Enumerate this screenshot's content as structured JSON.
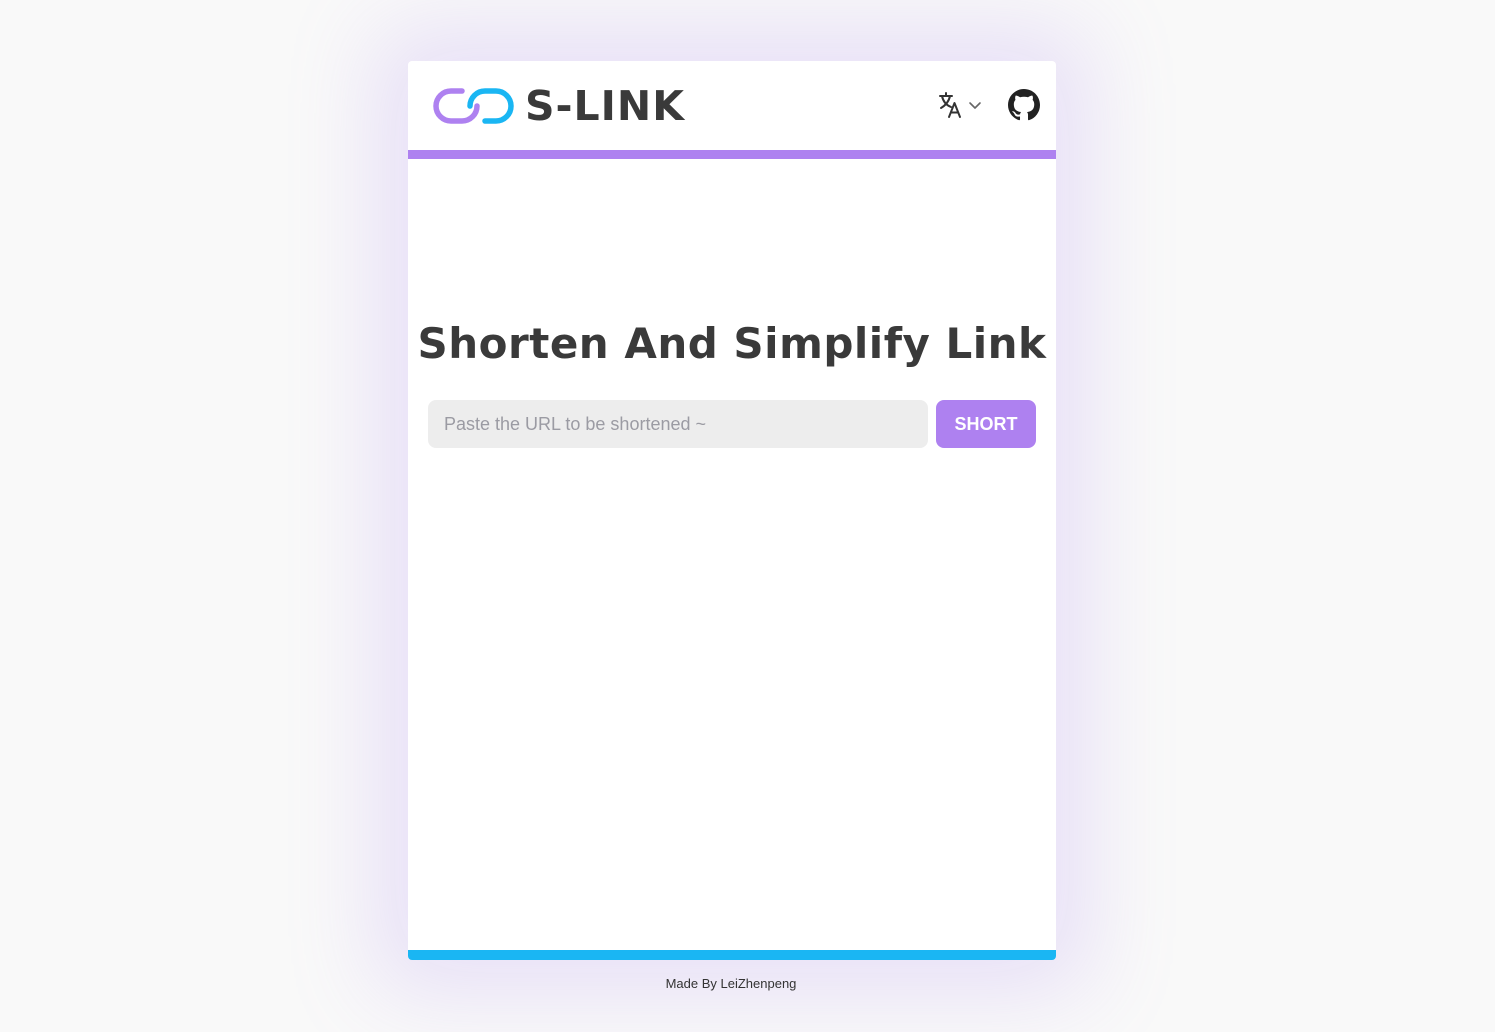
{
  "header": {
    "logo_text": "S-LINK",
    "logo_icon": "chain-link-icon",
    "language_icon": "translate-icon",
    "language_dropdown_icon": "chevron-down-icon",
    "github_icon": "github-icon"
  },
  "main": {
    "title": "Shorten And Simplify Link",
    "url_input": {
      "value": "",
      "placeholder": "Paste the URL to be shortened ~"
    },
    "short_button_label": "SHORT"
  },
  "footer": {
    "text": "Made By LeiZhenpeng"
  },
  "colors": {
    "accent_purple": "#ae81f0",
    "accent_blue": "#1ab6f3",
    "text_dark": "#3a3a3a",
    "input_bg": "#ededed",
    "page_bg": "#f9f9f9"
  }
}
